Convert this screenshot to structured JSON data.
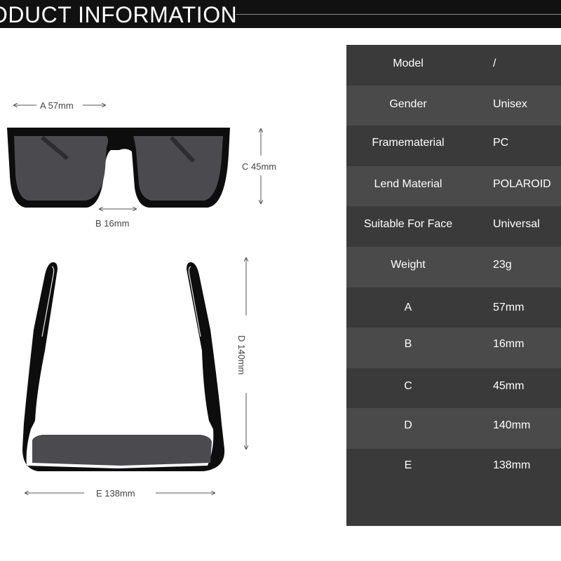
{
  "header": {
    "title": "ODUCT INFORMATION"
  },
  "dimensions": {
    "a": "A 57mm",
    "b": "B 16mm",
    "c": "C 45mm",
    "d": "D 140mm",
    "e": "E 138mm"
  },
  "specs": [
    {
      "label": "Model",
      "value": "/"
    },
    {
      "label": "Gender",
      "value": "Unisex"
    },
    {
      "label": "Framematerial",
      "value": "PC"
    },
    {
      "label": "Lend Material",
      "value": "POLAROID"
    },
    {
      "label": "Suitable For Face",
      "value": "Universal"
    },
    {
      "label": "Weight",
      "value": "23g"
    },
    {
      "label": "A",
      "value": "57mm"
    },
    {
      "label": "B",
      "value": "16mm"
    },
    {
      "label": "C",
      "value": "45mm"
    },
    {
      "label": "D",
      "value": "140mm"
    },
    {
      "label": "E",
      "value": "138mm"
    }
  ],
  "colors": {
    "header_bg": "#111111",
    "row_dark": "#3a3a3a",
    "row_light": "#4a4a4a",
    "frame": "#0d0d0d",
    "lens": "#4a4a4f"
  }
}
